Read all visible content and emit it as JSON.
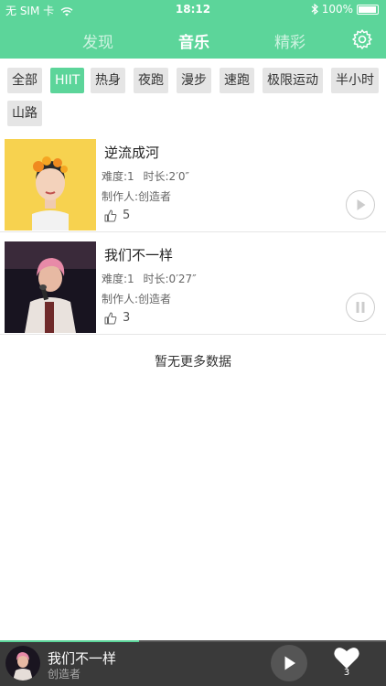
{
  "status_bar": {
    "carrier": "无 SIM 卡",
    "time": "18:12",
    "battery": "100%"
  },
  "nav": {
    "tabs": [
      "发现",
      "音乐",
      "精彩"
    ],
    "active": "音乐"
  },
  "tags": [
    "全部",
    "HIIT",
    "热身",
    "夜跑",
    "漫步",
    "速跑",
    "极限运动",
    "半小时",
    "山路"
  ],
  "active_tag": "HIIT",
  "songs": [
    {
      "title": "逆流成河",
      "difficulty": "难度:1",
      "duration": "时长:2′0″",
      "producer": "制作人:创造者",
      "likes": "5",
      "state": "play"
    },
    {
      "title": "我们不一样",
      "difficulty": "难度:1",
      "duration": "时长:0′27″",
      "producer": "制作人:创造者",
      "likes": "3",
      "state": "pause"
    }
  ],
  "no_more": "暂无更多数据",
  "player": {
    "title": "我们不一样",
    "artist": "创造者",
    "likes": "3",
    "progress": 0.36
  },
  "colors": {
    "accent": "#5cd59a",
    "player_bg": "#3a3a3a"
  }
}
